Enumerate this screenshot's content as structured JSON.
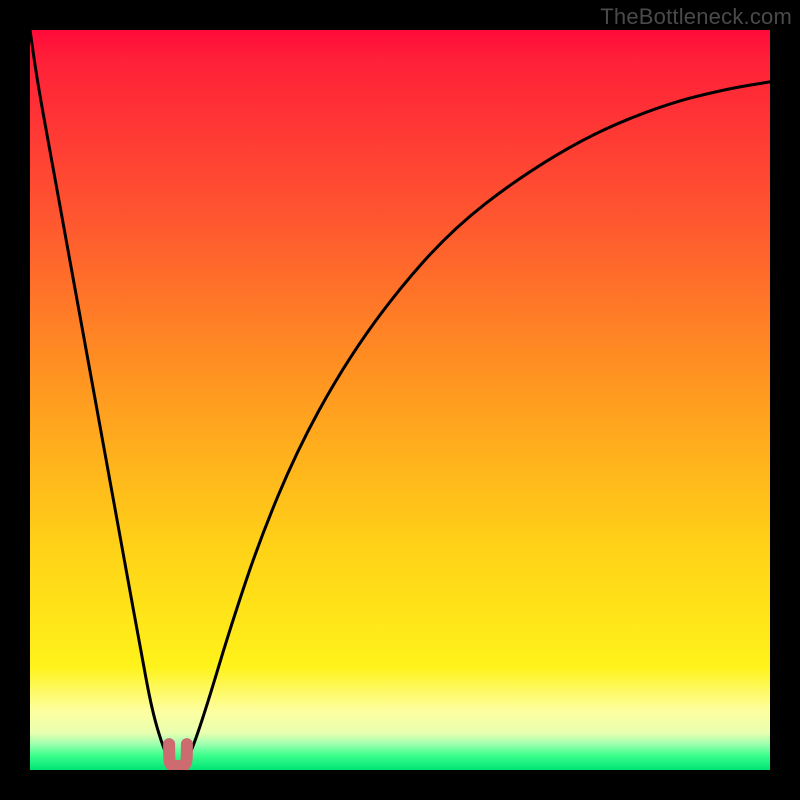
{
  "watermark": "TheBottleneck.com",
  "chart_data": {
    "type": "line",
    "title": "",
    "xlabel": "",
    "ylabel": "",
    "xlim": [
      0,
      100
    ],
    "ylim": [
      0,
      100
    ],
    "grid": false,
    "series": [
      {
        "name": "bottleneck-curve",
        "x": [
          0,
          1,
          3,
          5,
          7,
          9,
          11,
          13,
          15,
          16.5,
          18,
          19,
          19.7,
          20.3,
          21,
          22,
          24,
          27,
          31,
          36,
          42,
          49,
          57,
          66,
          76,
          86,
          94,
          100
        ],
        "values": [
          100,
          93,
          82,
          71,
          60,
          49,
          38,
          27,
          16,
          8,
          3,
          1,
          0,
          0,
          1,
          3,
          9,
          19,
          31,
          43,
          54,
          64,
          73,
          80,
          86,
          90,
          92,
          93
        ]
      }
    ],
    "min_marker": {
      "name": "min-region",
      "x": [
        18.8,
        21.2
      ],
      "y_approx": 2
    },
    "colors": {
      "curve": "#000000",
      "marker": "#cc6b70",
      "gradient_top": "#ff0a3a",
      "gradient_mid": "#ffd217",
      "gradient_bottom": "#00e474"
    }
  }
}
